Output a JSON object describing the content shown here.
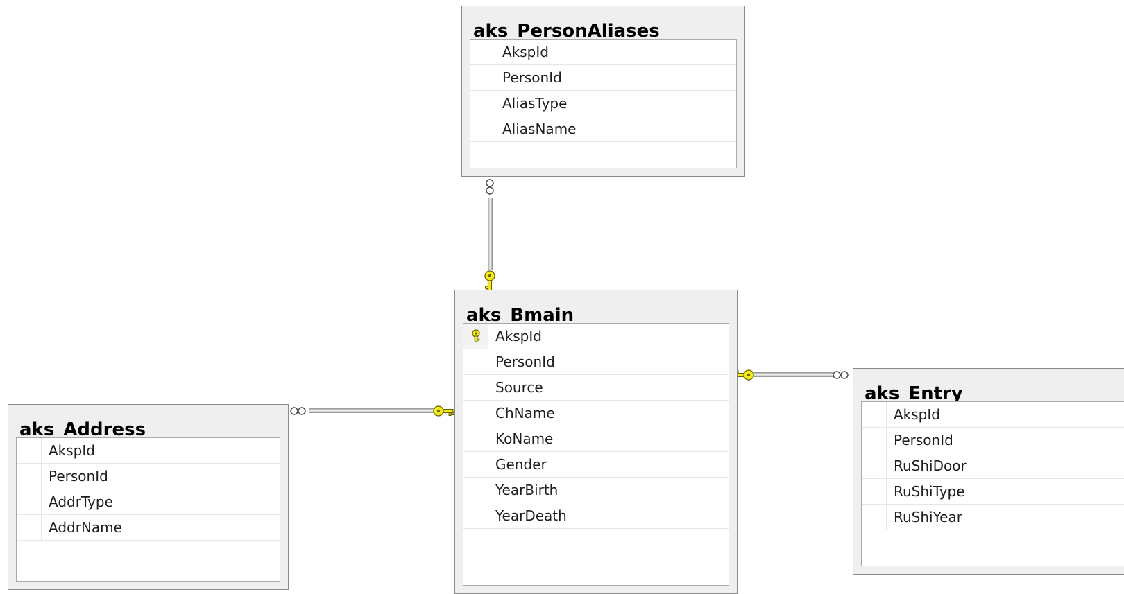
{
  "tables": {
    "person_aliases": {
      "title": "aks_PersonAliases",
      "columns": [
        "AkspId",
        "PersonId",
        "AliasType",
        "AliasName"
      ]
    },
    "bmain": {
      "title": "aks_Bmain",
      "columns": [
        "AkspId",
        "PersonId",
        "Source",
        "ChName",
        "KoName",
        "Gender",
        "YearBirth",
        "YearDeath"
      ],
      "primary_key": "AkspId"
    },
    "address": {
      "title": "aks_Address",
      "columns": [
        "AkspId",
        "PersonId",
        "AddrType",
        "AddrName"
      ]
    },
    "entry": {
      "title": "aks_Entry",
      "columns": [
        "AkspId",
        "PersonId",
        "RuShiDoor",
        "RuShiType",
        "RuShiYear"
      ]
    }
  },
  "relationships": [
    {
      "from": "aks_PersonAliases",
      "to": "aks_Bmain",
      "many_side": "aks_PersonAliases",
      "one_side": "aks_Bmain"
    },
    {
      "from": "aks_Address",
      "to": "aks_Bmain",
      "many_side": "aks_Address",
      "one_side": "aks_Bmain"
    },
    {
      "from": "aks_Entry",
      "to": "aks_Bmain",
      "many_side": "aks_Entry",
      "one_side": "aks_Bmain"
    }
  ],
  "icons": {
    "key": "key-icon",
    "infinity": "infinity-icon"
  },
  "colors": {
    "key": "#f2ea1d",
    "key_outline": "#6b6000",
    "connector": "#9c9c9c"
  }
}
